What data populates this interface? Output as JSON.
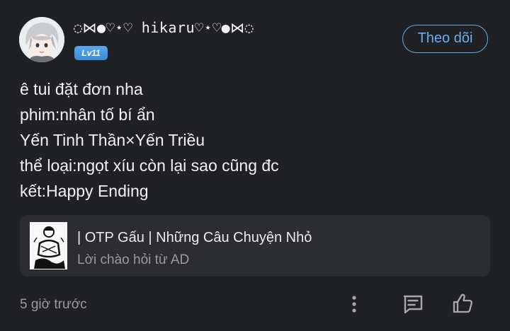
{
  "post": {
    "author": {
      "name": "◌⋈●♡⋆♡ hikaru♡⋆♡●⋈◌",
      "level": "Lv11"
    },
    "follow_label": "Theo dõi",
    "body_lines": [
      "ê tui đặt đơn nha",
      "phim:nhân tố bí ẩn",
      "Yến Tinh Thần×Yến Triều",
      "thể loại:ngọt xíu còn lại sao cũng đc",
      "kết:Happy Ending"
    ],
    "linked_card": {
      "title": "| OTP Gấu | Những Câu Chuyện Nhỏ",
      "subtitle": "Lời chào hỏi từ AD"
    },
    "timestamp": "5 giờ trước"
  },
  "icons": {
    "more": "more-vertical-icon",
    "comment": "comment-icon",
    "like": "thumbs-up-icon"
  },
  "colors": {
    "background": "#202124",
    "accent": "#62a8e8",
    "badge": "#4a9be4",
    "card": "#2c2d30",
    "muted_text": "#9a9a9a"
  }
}
